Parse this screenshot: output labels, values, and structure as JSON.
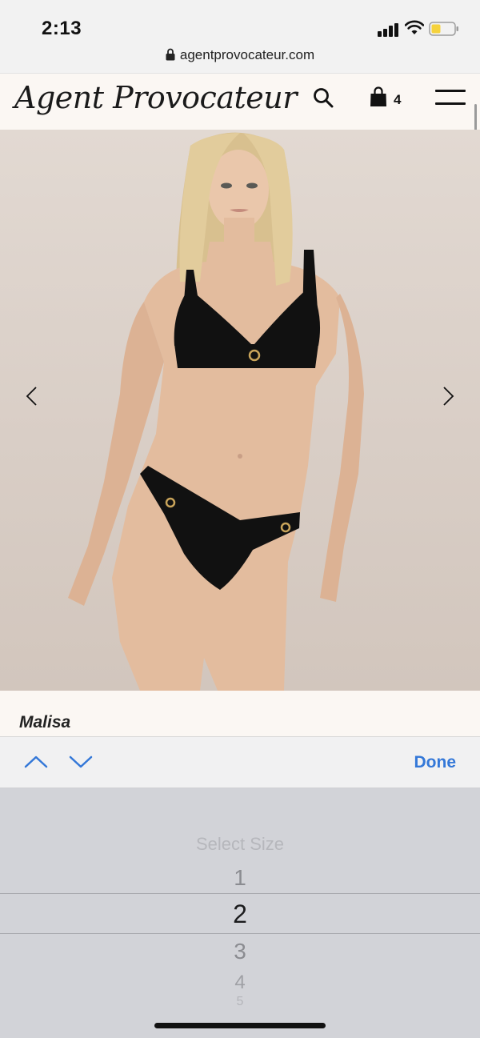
{
  "status_bar": {
    "time": "2:13"
  },
  "browser": {
    "url": "agentprovocateur.com"
  },
  "header": {
    "logo": "Agent Provocateur",
    "bag_count": "4"
  },
  "product": {
    "name": "Malisa"
  },
  "accessory_bar": {
    "done_label": "Done"
  },
  "picker": {
    "options": [
      "Select Size",
      "1",
      "2",
      "3",
      "4",
      "5"
    ],
    "selected": "2"
  },
  "colors": {
    "accent": "#3478d8",
    "header_bg": "#fbf7f3",
    "picker_bg": "#d2d3d8",
    "battery_fill": "#f5d23c"
  },
  "icons": [
    "lock-icon",
    "search-icon",
    "shopping-bag-icon",
    "hamburger-menu-icon",
    "chevron-left-icon",
    "chevron-right-icon",
    "chevron-up-icon",
    "chevron-down-icon",
    "signal-icon",
    "wifi-icon",
    "battery-icon"
  ]
}
